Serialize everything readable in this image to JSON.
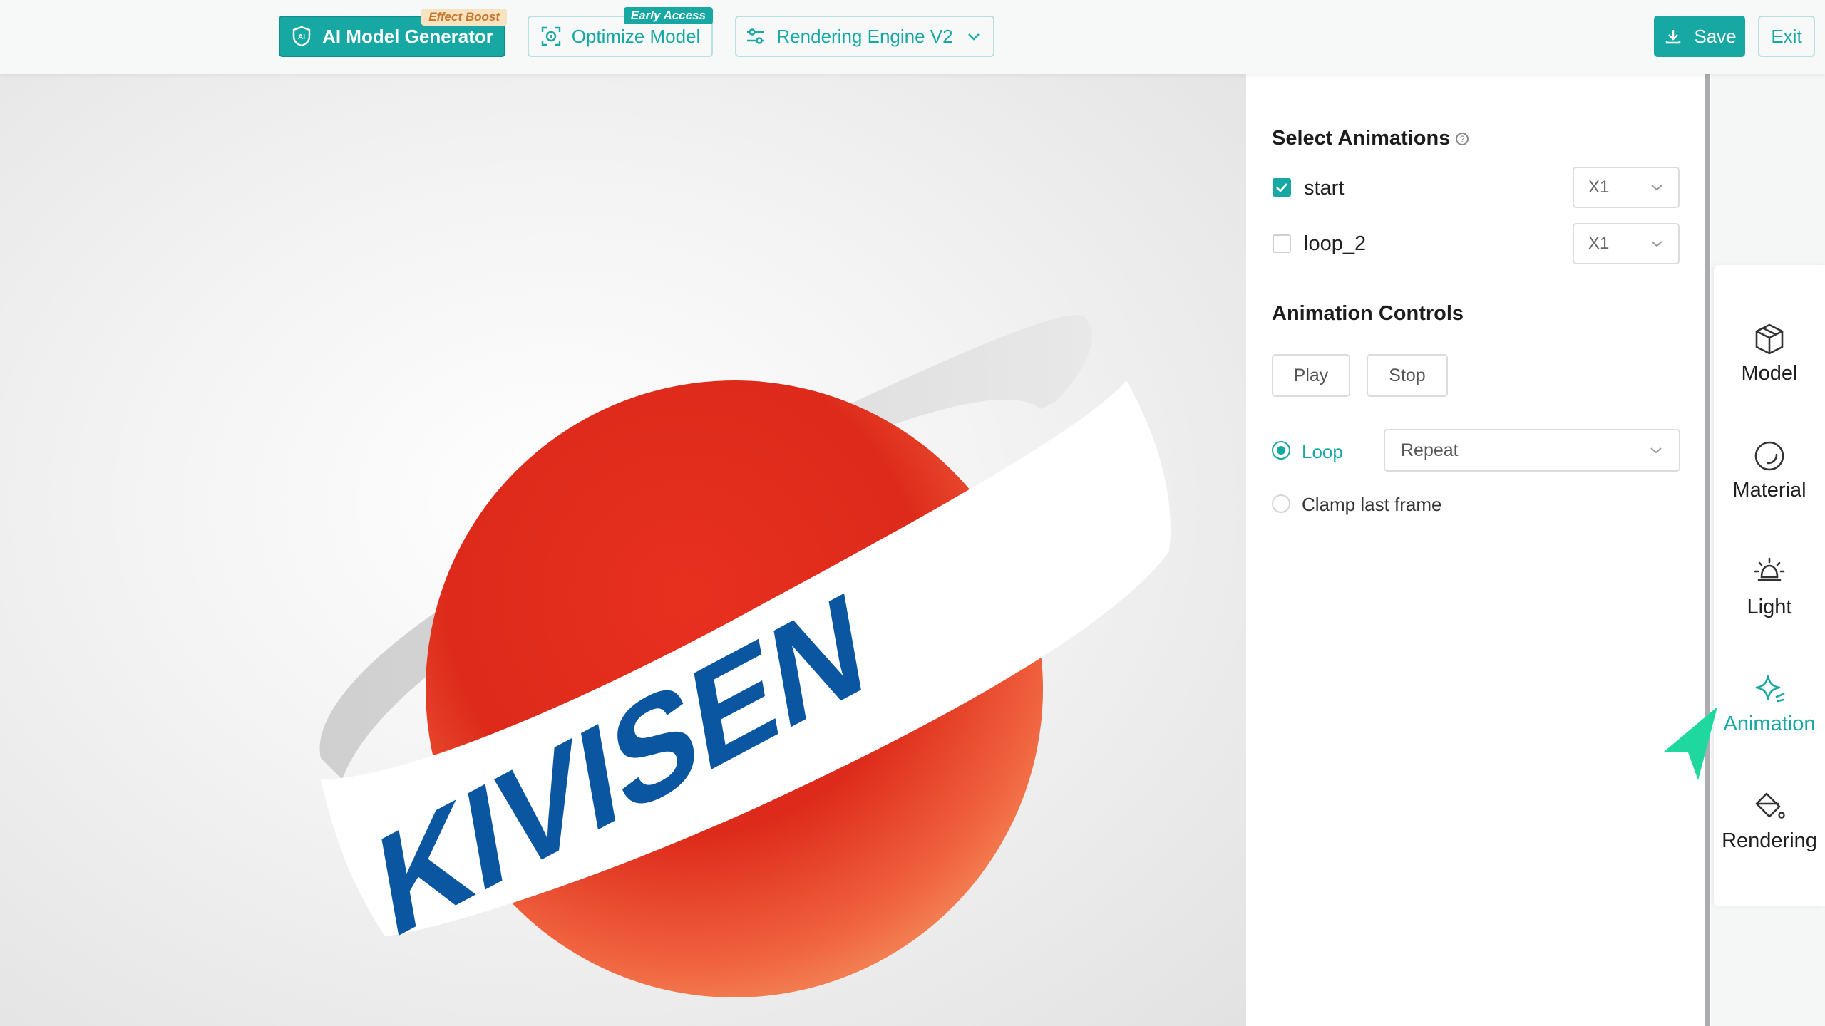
{
  "topbar": {
    "ai_generator": {
      "label": "AI Model Generator",
      "badge": "Effect Boost"
    },
    "optimize": {
      "label": "Optimize Model",
      "badge": "Early Access"
    },
    "engine": {
      "label": "Rendering Engine V2"
    },
    "save": "Save",
    "exit": "Exit"
  },
  "viewport": {
    "model_text": "KIVISEN"
  },
  "panel": {
    "select_title": "Select Animations",
    "help_glyph": "?",
    "animations": [
      {
        "name": "start",
        "checked": true,
        "speed": "X1"
      },
      {
        "name": "loop_2",
        "checked": false,
        "speed": "X1"
      }
    ],
    "controls_title": "Animation Controls",
    "play": "Play",
    "stop": "Stop",
    "loop_label": "Loop",
    "loop_mode": "Repeat",
    "clamp_label": "Clamp last frame"
  },
  "nav": {
    "items": [
      {
        "label": "Model",
        "icon": "cube-icon"
      },
      {
        "label": "Material",
        "icon": "sphere-icon"
      },
      {
        "label": "Light",
        "icon": "bulb-icon"
      },
      {
        "label": "Animation",
        "icon": "sparkle-icon",
        "active": true
      },
      {
        "label": "Rendering",
        "icon": "paint-bucket-icon"
      }
    ]
  },
  "colors": {
    "accent": "#17a8a3",
    "badge_effect": "#f6e3c2",
    "sphere": "#e8301f",
    "logo_blue": "#0a56a0"
  }
}
